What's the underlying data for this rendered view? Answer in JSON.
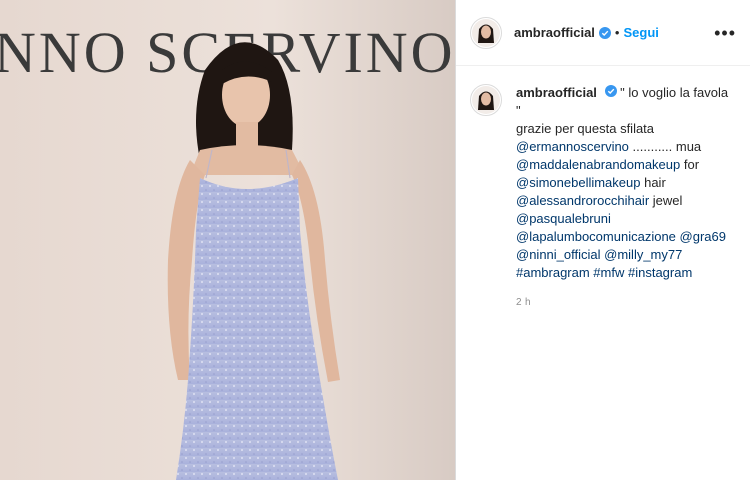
{
  "post": {
    "brand_text": "NNO SCERVINO"
  },
  "header": {
    "username": "ambraofficial",
    "separator": "•",
    "follow_label": "Segui",
    "more_label": "•••"
  },
  "caption": {
    "username": "ambraofficial",
    "line1": "\" lo voglio la favola \"",
    "line2": "grazie per questa sfilata",
    "line3_mention": "@ermannoscervino",
    "line3_text": " ........... mua",
    "line4_mention": "@maddalenabrandomakeup",
    "line4_text": " for",
    "line5_mention": "@simonebellimakeup",
    "line5_text": " hair",
    "line6_mention": "@alessandrorocchihair",
    "line6_text": " jewel",
    "line7_mention": "@pasqualebruni",
    "line8_mention": "@lapalumbocomunicazione",
    "line8_mention2": "@gra69",
    "line9_mention": "@ninni_official",
    "line9_mention2": "@milly_my77",
    "line10_tags": "#ambragram #mfw #instagram",
    "time": "2 h"
  },
  "colors": {
    "link": "#00376b",
    "follow": "#0095f6",
    "verified": "#3897f0"
  },
  "icons": {
    "verified": "verified-badge-icon",
    "more": "more-options-icon"
  }
}
